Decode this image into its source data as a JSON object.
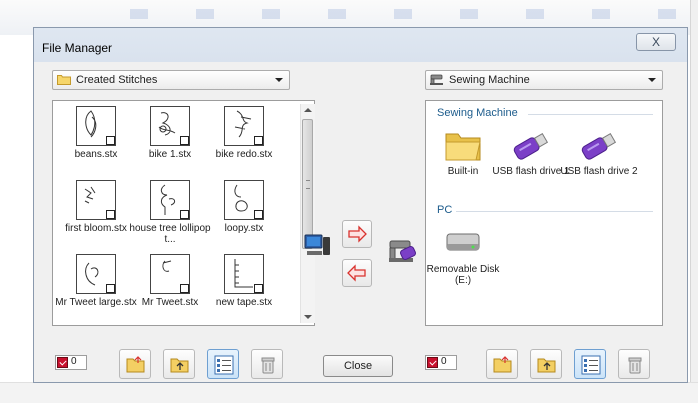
{
  "window": {
    "title": "File Manager",
    "close_glyph": "X"
  },
  "left": {
    "dropdown_label": "Created Stitches",
    "dropdown_icon": "folder-icon",
    "files": [
      {
        "label": "beans.stx"
      },
      {
        "label": "bike 1.stx"
      },
      {
        "label": "bike redo.stx"
      },
      {
        "label": "first bloom.stx"
      },
      {
        "label": "house tree lollipop t..."
      },
      {
        "label": "loopy.stx"
      },
      {
        "label": "Mr Tweet large.stx"
      },
      {
        "label": "Mr Tweet.stx"
      },
      {
        "label": "new tape.stx"
      }
    ],
    "count": "0"
  },
  "right": {
    "dropdown_label": "Sewing Machine",
    "dropdown_icon": "sewing-machine-icon",
    "groups": [
      {
        "header": "Sewing Machine",
        "items": [
          {
            "label": "Built-in",
            "icon": "folder-icon"
          },
          {
            "label": "USB flash drive 1",
            "icon": "usb-drive-icon"
          },
          {
            "label": "USB flash drive 2",
            "icon": "usb-drive-icon"
          }
        ]
      },
      {
        "header": "PC",
        "items": [
          {
            "label": "Removable Disk (E:)",
            "icon": "removable-disk-icon"
          }
        ]
      }
    ],
    "count": "0"
  },
  "transfer": {
    "to_machine_icon": "arrow-right-icon",
    "to_pc_icon": "arrow-left-icon"
  },
  "close_button": "Close",
  "colors": {
    "accent_red": "#d9322e",
    "group_header": "#1d5c8c",
    "usb_purple": "#7b3fc7"
  }
}
